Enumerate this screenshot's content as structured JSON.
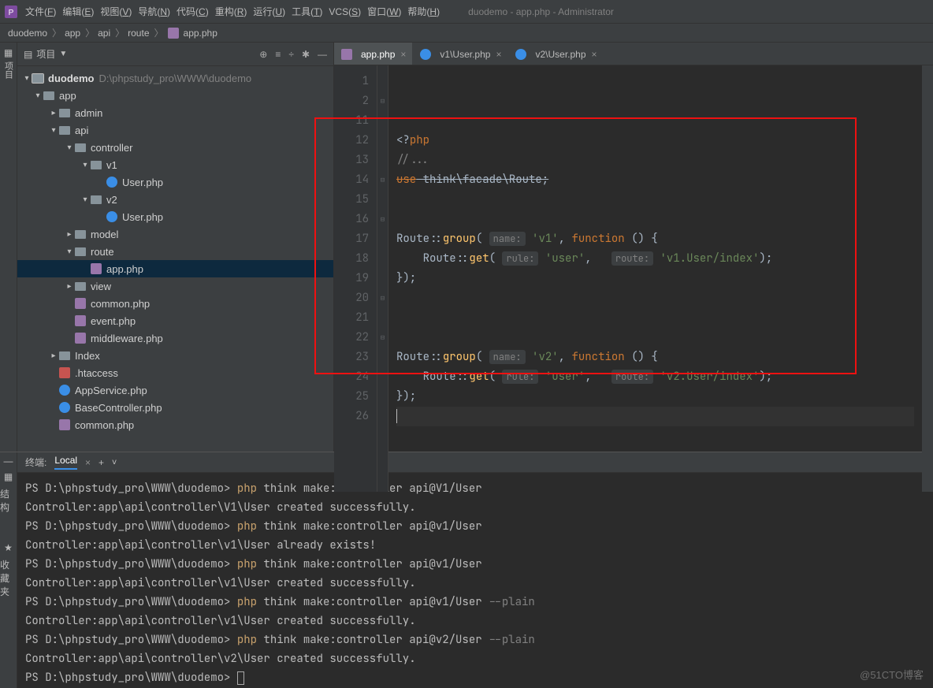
{
  "menubar": {
    "items": [
      "文件(F)",
      "编辑(E)",
      "视图(V)",
      "导航(N)",
      "代码(C)",
      "重构(R)",
      "运行(U)",
      "工具(T)",
      "VCS(S)",
      "窗口(W)",
      "帮助(H)"
    ],
    "window_title": "duodemo - app.php - Administrator"
  },
  "breadcrumbs": [
    "duodemo",
    "app",
    "api",
    "route",
    "app.php"
  ],
  "sidebar": {
    "label": "项目",
    "root": {
      "name": "duodemo",
      "path": "D:\\phpstudy_pro\\WWW\\duodemo"
    },
    "items": [
      {
        "type": "folder",
        "name": "app",
        "depth": 1,
        "open": true
      },
      {
        "type": "folder",
        "name": "admin",
        "depth": 2,
        "open": false
      },
      {
        "type": "folder",
        "name": "api",
        "depth": 2,
        "open": true
      },
      {
        "type": "folder",
        "name": "controller",
        "depth": 3,
        "open": true
      },
      {
        "type": "folder",
        "name": "v1",
        "depth": 4,
        "open": true
      },
      {
        "type": "class",
        "name": "User.php",
        "depth": 5
      },
      {
        "type": "folder",
        "name": "v2",
        "depth": 4,
        "open": true
      },
      {
        "type": "class",
        "name": "User.php",
        "depth": 5
      },
      {
        "type": "folder",
        "name": "model",
        "depth": 3,
        "open": false
      },
      {
        "type": "folder",
        "name": "route",
        "depth": 3,
        "open": true
      },
      {
        "type": "php",
        "name": "app.php",
        "depth": 4,
        "selected": true
      },
      {
        "type": "folder",
        "name": "view",
        "depth": 3,
        "open": false
      },
      {
        "type": "php",
        "name": "common.php",
        "depth": 3
      },
      {
        "type": "php",
        "name": "event.php",
        "depth": 3
      },
      {
        "type": "php",
        "name": "middleware.php",
        "depth": 3
      },
      {
        "type": "folder",
        "name": "Index",
        "depth": 2,
        "open": false
      },
      {
        "type": "ht",
        "name": ".htaccess",
        "depth": 2
      },
      {
        "type": "class",
        "name": "AppService.php",
        "depth": 2
      },
      {
        "type": "class",
        "name": "BaseController.php",
        "depth": 2
      },
      {
        "type": "php",
        "name": "common.php",
        "depth": 2
      }
    ]
  },
  "tabs": [
    {
      "label": "app.php",
      "icon": "php",
      "active": true
    },
    {
      "label": "v1\\User.php",
      "icon": "class",
      "active": false
    },
    {
      "label": "v2\\User.php",
      "icon": "class",
      "active": false
    }
  ],
  "code": {
    "line_numbers": [
      1,
      2,
      11,
      12,
      13,
      14,
      15,
      16,
      17,
      18,
      19,
      20,
      21,
      22,
      23,
      24,
      25,
      26
    ],
    "lines": [
      {
        "n": 1,
        "html": "<span class='tok-id'>&lt;?</span><span class='tok-kw'>php</span>"
      },
      {
        "n": 2,
        "html": "<span class='tok-cm'>//...</span>",
        "fold": "⊟"
      },
      {
        "n": 11,
        "html": "<span class='tok-kw strike'>use</span><span class='tok-id strike'> think\\facade\\Route;</span>"
      },
      {
        "n": 12,
        "html": ""
      },
      {
        "n": 13,
        "html": ""
      },
      {
        "n": 14,
        "html": "<span class='tok-id'>Route</span><span class='tok-id'>::</span><span class='tok-fn'>group</span><span class='tok-id'>(</span> <span class='param-hint'>name:</span> <span class='tok-str'>'v1'</span><span class='tok-id'>, </span><span class='tok-kw'>function</span><span class='tok-id'> () {</span>",
        "fold": "⊟"
      },
      {
        "n": 15,
        "html": "    <span class='tok-id'>Route</span><span class='tok-id'>::</span><span class='tok-fn'>get</span><span class='tok-id'>(</span> <span class='param-hint'>rule:</span> <span class='tok-str'>'user'</span><span class='tok-id'>,   </span><span class='param-hint'>route:</span> <span class='tok-str'>'v1.User/index'</span><span class='tok-id'>);</span>"
      },
      {
        "n": 16,
        "html": "<span class='tok-id'>});</span>",
        "fold": "⊟"
      },
      {
        "n": 17,
        "html": ""
      },
      {
        "n": 18,
        "html": ""
      },
      {
        "n": 19,
        "html": ""
      },
      {
        "n": 20,
        "html": "<span class='tok-id'>Route</span><span class='tok-id'>::</span><span class='tok-fn'>group</span><span class='tok-id'>(</span> <span class='param-hint'>name:</span> <span class='tok-str'>'v2'</span><span class='tok-id'>, </span><span class='tok-kw'>function</span><span class='tok-id'> () {</span>",
        "fold": "⊟"
      },
      {
        "n": 21,
        "html": "    <span class='tok-id'>Route</span><span class='tok-id'>::</span><span class='tok-fn'>get</span><span class='tok-id'>(</span> <span class='param-hint'>rule:</span> <span class='tok-str'>'user'</span><span class='tok-id'>,   </span><span class='param-hint'>route:</span> <span class='tok-str'>'v2.User/index'</span><span class='tok-id'>);</span>"
      },
      {
        "n": 22,
        "html": "<span class='tok-id'>});</span>",
        "fold": "⊟"
      },
      {
        "n": 23,
        "html": "<span class='caret'></span>",
        "caret": true
      },
      {
        "n": 24,
        "html": ""
      },
      {
        "n": 25,
        "html": ""
      },
      {
        "n": 26,
        "html": ""
      }
    ]
  },
  "terminal": {
    "title": "终端:",
    "tab": "Local",
    "lines": [
      {
        "text": "PS D:\\phpstudy_pro\\WWW\\duodemo> ",
        "cmd": "php",
        "rest": " think make:controller api@V1/User"
      },
      {
        "text": "Controller:app\\api\\controller\\V1\\User created successfully."
      },
      {
        "text": "PS D:\\phpstudy_pro\\WWW\\duodemo> ",
        "cmd": "php",
        "rest": " think make:controller api@v1/User"
      },
      {
        "text": "Controller:app\\api\\controller\\v1\\User already exists!"
      },
      {
        "text": "PS D:\\phpstudy_pro\\WWW\\duodemo> ",
        "cmd": "php",
        "rest": " think make:controller api@v1/User"
      },
      {
        "text": "Controller:app\\api\\controller\\v1\\User created successfully."
      },
      {
        "text": "PS D:\\phpstudy_pro\\WWW\\duodemo> ",
        "cmd": "php",
        "rest": " think make:controller api@v1/User ",
        "flag": "--plain"
      },
      {
        "text": "Controller:app\\api\\controller\\v1\\User created successfully."
      },
      {
        "text": "PS D:\\phpstudy_pro\\WWW\\duodemo> ",
        "cmd": "php",
        "rest": " think make:controller api@v2/User ",
        "flag": "--plain"
      },
      {
        "text": "Controller:app\\api\\controller\\v2\\User created successfully."
      },
      {
        "text": "PS D:\\phpstudy_pro\\WWW\\duodemo> ",
        "cursor": true
      }
    ]
  },
  "right_rail": [
    "结构",
    "收藏夹"
  ],
  "watermark": "@51CTO博客"
}
